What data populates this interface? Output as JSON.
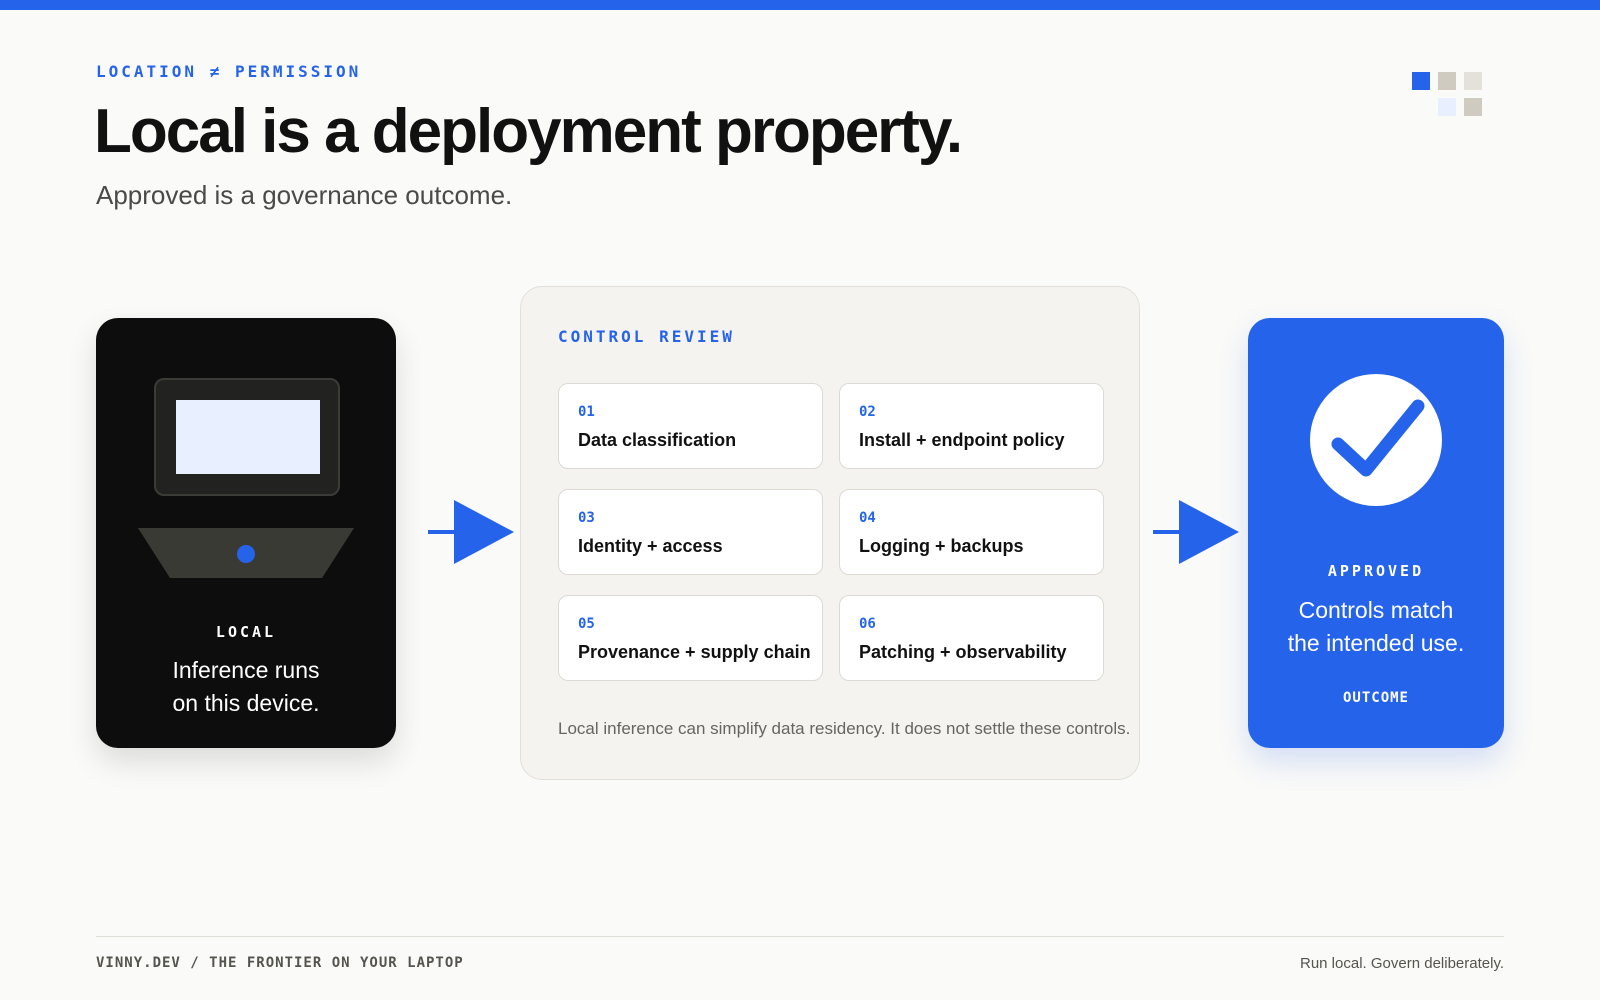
{
  "header": {
    "eyebrow": "LOCATION ≠ PERMISSION",
    "title": "Local is a deployment property.",
    "subtitle": "Approved is a governance outcome."
  },
  "local_card": {
    "icon": "laptop-icon",
    "label": "LOCAL",
    "text_line1": "Inference runs",
    "text_line2": "on this device."
  },
  "control_review": {
    "title": "CONTROL REVIEW",
    "items": [
      {
        "num": "01",
        "label": "Data classification"
      },
      {
        "num": "02",
        "label": "Install + endpoint policy"
      },
      {
        "num": "03",
        "label": "Identity + access"
      },
      {
        "num": "04",
        "label": "Logging + backups"
      },
      {
        "num": "05",
        "label": "Provenance + supply chain"
      },
      {
        "num": "06",
        "label": "Patching + observability"
      }
    ],
    "note": "Local inference can simplify data residency. It does not settle these controls."
  },
  "approved_card": {
    "icon": "checkmark-icon",
    "label": "APPROVED",
    "text_line1": "Controls match",
    "text_line2": "the intended use.",
    "tag": "OUTCOME"
  },
  "footer": {
    "left": "VINNY.DEV / THE FRONTIER ON YOUR LAPTOP",
    "right": "Run local. Govern deliberately."
  },
  "colors": {
    "accent": "#2563eb",
    "dark_card": "#0d0d0d",
    "background": "#fafaf8",
    "panel": "#f4f3f0"
  }
}
